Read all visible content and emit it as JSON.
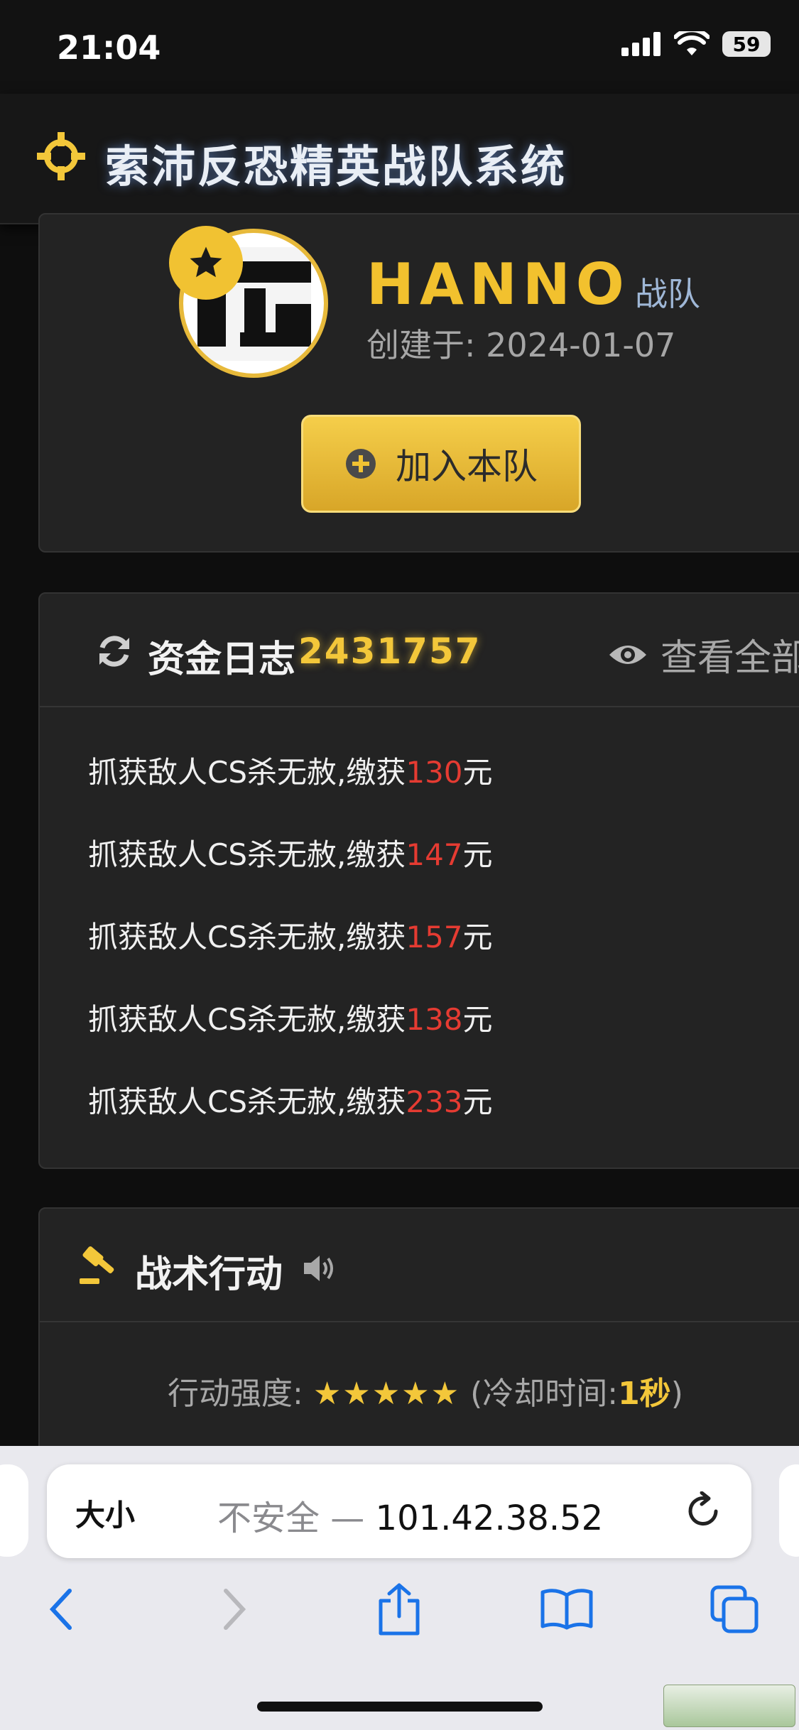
{
  "status": {
    "time": "21:04",
    "battery": "59"
  },
  "header": {
    "title": "索沛反恐精英战队系统",
    "icon": "crosshair-icon"
  },
  "team": {
    "name": "HANNO",
    "suffix": "战队",
    "created": "创建于: 2024-01-07",
    "join_label": "加入本队"
  },
  "funds": {
    "title": "资金日志",
    "count": "2431757",
    "view_all": "查看全部",
    "logs": [
      {
        "text": "抓获敌人CS杀无赦,缴获",
        "amount": "130",
        "unit": "元"
      },
      {
        "text": "抓获敌人CS杀无赦,缴获",
        "amount": "147",
        "unit": "元"
      },
      {
        "text": "抓获敌人CS杀无赦,缴获",
        "amount": "157",
        "unit": "元"
      },
      {
        "text": "抓获敌人CS杀无赦,缴获",
        "amount": "138",
        "unit": "元"
      },
      {
        "text": "抓获敌人CS杀无赦,缴获",
        "amount": "233",
        "unit": "元"
      }
    ]
  },
  "tactics": {
    "title": "战术行动",
    "intensity_label": "行动强度:",
    "stars": "★★★★★",
    "star_rating": 5,
    "cooldown_open": "(冷却时间:",
    "cooldown_value": "1秒",
    "cooldown_close": ")"
  },
  "browser": {
    "size_label": "大小",
    "insecure": "不安全 — ",
    "host": "101.42.38.52"
  },
  "colors": {
    "accent": "#f3c73a",
    "amount": "#e53b32",
    "background": "#0e0e0e"
  }
}
